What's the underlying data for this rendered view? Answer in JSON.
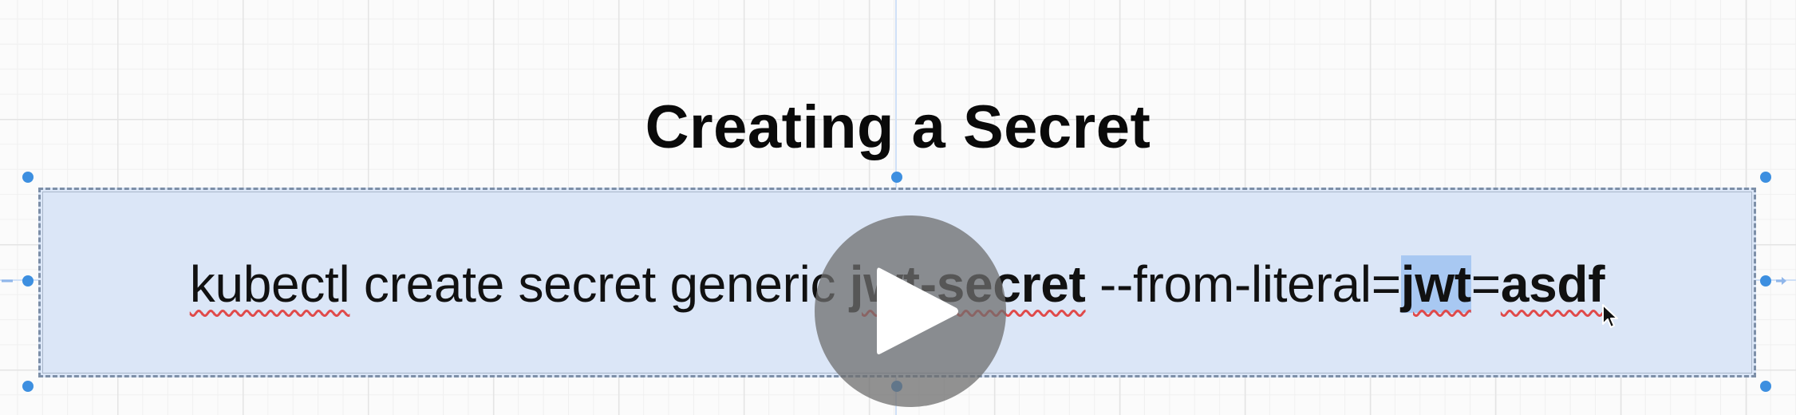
{
  "slide": {
    "title": "Creating a Secret"
  },
  "command": {
    "part_kubectl": "kubectl",
    "part_create": " create secret generic ",
    "part_secret_name": "jwt-secret",
    "part_from_literal": " --from-literal=",
    "part_key": "jwt",
    "part_equals": "=",
    "part_value": "asdf"
  },
  "video": {
    "play_icon": "play-icon"
  },
  "colors": {
    "shape_fill": "#dbe6f7",
    "selection_handle": "#3d8fe0",
    "spellcheck_underline": "#e04a4a",
    "text_highlight": "#a8c8f2"
  }
}
